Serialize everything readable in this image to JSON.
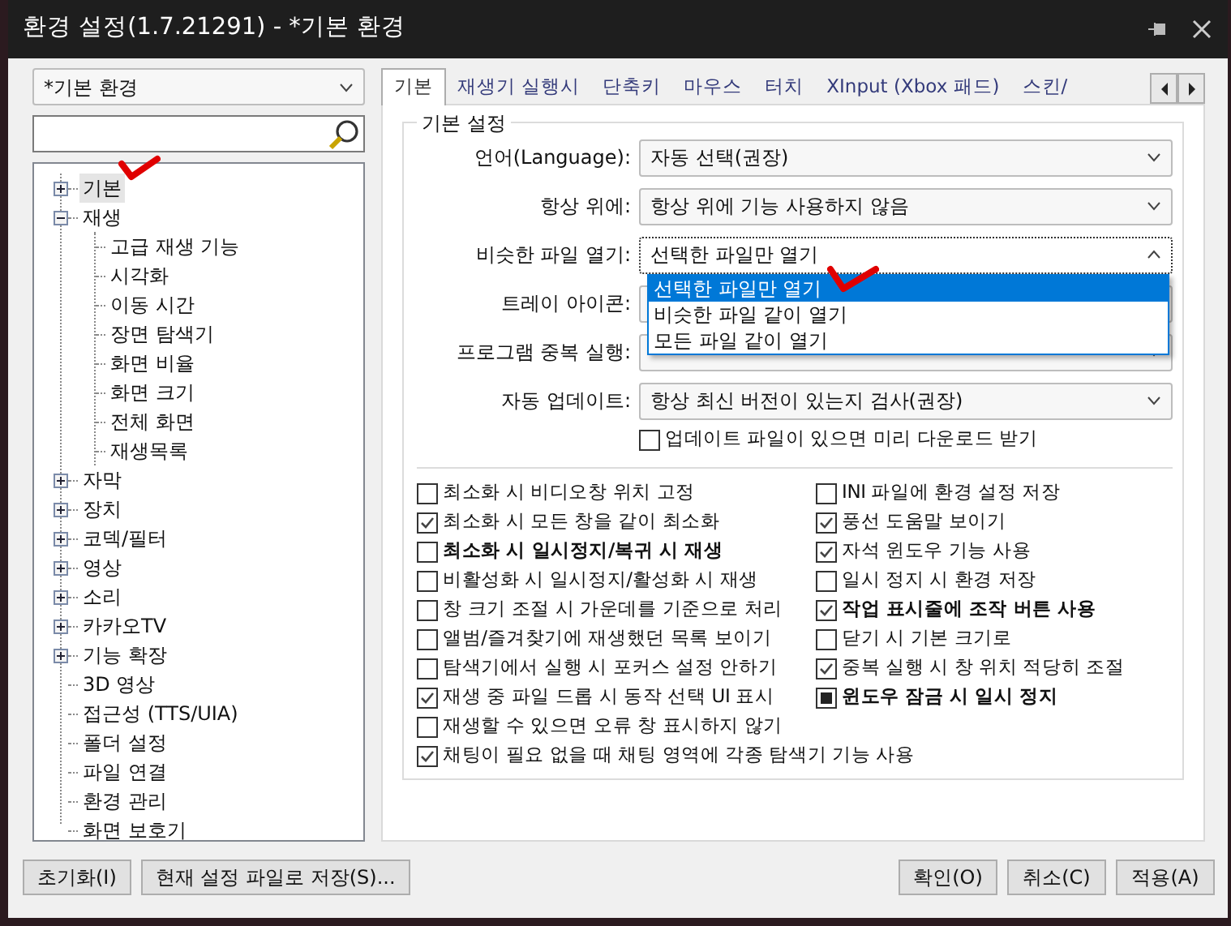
{
  "window": {
    "title": "환경 설정(1.7.21291) - *기본 환경"
  },
  "profile_combo": {
    "value": "*기본 환경"
  },
  "tree": [
    {
      "label": "기본",
      "kind": "folder",
      "expanded": false,
      "selected": true
    },
    {
      "label": "재생",
      "kind": "folder",
      "expanded": true,
      "selected": false,
      "children": [
        {
          "label": "고급 재생 기능",
          "kind": "leaf",
          "selected": false
        },
        {
          "label": "시각화",
          "kind": "leaf",
          "selected": false
        },
        {
          "label": "이동 시간",
          "kind": "leaf",
          "selected": false
        },
        {
          "label": "장면 탐색기",
          "kind": "leaf",
          "selected": false
        },
        {
          "label": "화면 비율",
          "kind": "leaf",
          "selected": false
        },
        {
          "label": "화면 크기",
          "kind": "leaf",
          "selected": false
        },
        {
          "label": "전체 화면",
          "kind": "leaf",
          "selected": false
        },
        {
          "label": "재생목록",
          "kind": "leaf",
          "selected": false
        }
      ]
    },
    {
      "label": "자막",
      "kind": "folder",
      "expanded": false,
      "selected": false
    },
    {
      "label": "장치",
      "kind": "folder",
      "expanded": false,
      "selected": false
    },
    {
      "label": "코덱/필터",
      "kind": "folder",
      "expanded": false,
      "selected": false
    },
    {
      "label": "영상",
      "kind": "folder",
      "expanded": false,
      "selected": false
    },
    {
      "label": "소리",
      "kind": "folder",
      "expanded": false,
      "selected": false
    },
    {
      "label": "카카오TV",
      "kind": "folder",
      "expanded": false,
      "selected": false
    },
    {
      "label": "기능 확장",
      "kind": "folder",
      "expanded": false,
      "selected": false
    },
    {
      "label": "3D 영상",
      "kind": "leaf",
      "selected": false
    },
    {
      "label": "접근성 (TTS/UIA)",
      "kind": "leaf",
      "selected": false
    },
    {
      "label": "폴더 설정",
      "kind": "leaf",
      "selected": false
    },
    {
      "label": "파일 연결",
      "kind": "leaf",
      "selected": false
    },
    {
      "label": "환경 관리",
      "kind": "leaf",
      "selected": false
    },
    {
      "label": "화면 보호기",
      "kind": "leaf",
      "selected": false
    }
  ],
  "tabs": [
    {
      "label": "기본",
      "selected": true
    },
    {
      "label": "재생기 실행시",
      "selected": false
    },
    {
      "label": "단축키",
      "selected": false
    },
    {
      "label": "마우스",
      "selected": false
    },
    {
      "label": "터치",
      "selected": false
    },
    {
      "label": "XInput (Xbox 패드)",
      "selected": false
    },
    {
      "label": "스킨/",
      "selected": false
    }
  ],
  "group": {
    "title": "기본 설정"
  },
  "settings": [
    {
      "label": "언어(Language):",
      "value": "자동 선택(권장)",
      "open": false
    },
    {
      "label": "항상 위에:",
      "value": "항상 위에 기능 사용하지 않음",
      "open": false
    },
    {
      "label": "비슷한 파일 열기:",
      "value": "선택한 파일만 열기",
      "open": true
    },
    {
      "label": "트레이 아이콘:",
      "open": false
    },
    {
      "label": "프로그램 중복 실행:",
      "open": false
    },
    {
      "label": "자동 업데이트:",
      "value": "항상 최신 버전이 있는지 검사(권장)",
      "open": false
    }
  ],
  "dropdown": [
    {
      "label": "선택한 파일만 열기",
      "selected": true
    },
    {
      "label": "비슷한 파일 같이 열기",
      "selected": false
    },
    {
      "label": "모든 파일 같이 열기",
      "selected": false
    }
  ],
  "update_checkbox": {
    "label": "업데이트 파일이 있으면 미리 다운로드 받기",
    "checked": false
  },
  "left_options": [
    {
      "label": "최소화 시 비디오창 위치 고정",
      "checked": false,
      "bold": false
    },
    {
      "label": "최소화 시 모든 창을 같이 최소화",
      "checked": true,
      "bold": false
    },
    {
      "label": "최소화 시 일시정지/복귀 시 재생",
      "checked": false,
      "bold": true
    },
    {
      "label": "비활성화 시 일시정지/활성화 시 재생",
      "checked": false,
      "bold": false
    },
    {
      "label": "창 크기 조절 시 가운데를 기준으로 처리",
      "checked": false,
      "bold": false
    },
    {
      "label": "앨범/즐겨찾기에 재생했던 목록 보이기",
      "checked": false,
      "bold": false
    },
    {
      "label": "탐색기에서 실행 시 포커스 설정 안하기",
      "checked": false,
      "bold": false
    },
    {
      "label": "재생 중 파일 드롭 시 동작 선택 UI 표시",
      "checked": true,
      "bold": false
    },
    {
      "label": "재생할 수 있으면 오류 창 표시하지 않기",
      "checked": false,
      "bold": false
    },
    {
      "label": "채팅이 필요 없을 때 채팅 영역에 각종 탐색기 기능 사용",
      "checked": true,
      "bold": false
    }
  ],
  "right_options": [
    {
      "label": "INI 파일에 환경 설정 저장",
      "checked": false,
      "indeterminate": false,
      "bold": false
    },
    {
      "label": "풍선 도움말 보이기",
      "checked": true,
      "indeterminate": false,
      "bold": false
    },
    {
      "label": "자석 윈도우 기능 사용",
      "checked": true,
      "indeterminate": false,
      "bold": false
    },
    {
      "label": "일시 정지 시 환경 저장",
      "checked": false,
      "indeterminate": false,
      "bold": false
    },
    {
      "label": "작업 표시줄에 조작 버튼 사용",
      "checked": true,
      "indeterminate": false,
      "bold": true
    },
    {
      "label": "닫기 시 기본 크기로",
      "checked": false,
      "indeterminate": false,
      "bold": false
    },
    {
      "label": "중복 실행 시 창 위치 적당히 조절",
      "checked": true,
      "indeterminate": false,
      "bold": false
    },
    {
      "label": "윈도우 잠금 시 일시 정지",
      "checked": false,
      "indeterminate": true,
      "bold": true
    }
  ],
  "footer_left": [
    "초기화(I)",
    "현재 설정 파일로 저장(S)..."
  ],
  "footer_right": [
    "확인(O)",
    "취소(C)",
    "적용(A)"
  ]
}
